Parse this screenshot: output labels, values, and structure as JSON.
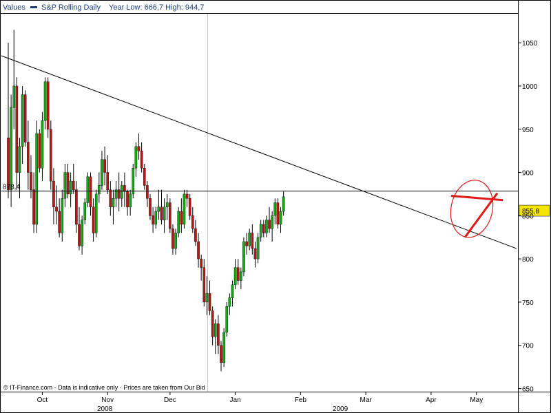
{
  "header": {
    "values_label": "Values",
    "series_label": "S&P Rolling Daily",
    "stats_label": "Year Low: 666,7 High: 944,7"
  },
  "footer": {
    "copyright": "© IT-Finance.com - Data is indicative only - Prices are taken from Our Bid"
  },
  "price_marker": {
    "value": "855,8",
    "color": "#f3e500"
  },
  "level_label": "878,4",
  "colors": {
    "up": "#1aa81a",
    "down": "#b81818",
    "annotation": "#e01818",
    "trendline": "#000000"
  },
  "chart_data": {
    "type": "candlestick",
    "title": "S&P Rolling Daily",
    "ylim": [
      648,
      1082
    ],
    "y_ticks": [
      650,
      700,
      750,
      800,
      850,
      900,
      950,
      1000,
      1050
    ],
    "months": [
      {
        "label": "Oct",
        "idx": 12
      },
      {
        "label": "Nov",
        "idx": 35
      },
      {
        "label": "Dec",
        "idx": 57
      },
      {
        "label": "Jan",
        "idx": 80
      },
      {
        "label": "Feb",
        "idx": 103
      },
      {
        "label": "Mar",
        "idx": 126
      },
      {
        "label": "Apr",
        "idx": 149
      },
      {
        "label": "May",
        "idx": 165
      }
    ],
    "years": [
      {
        "label": "2008",
        "idx": 34
      },
      {
        "label": "2009",
        "idx": 117
      }
    ],
    "horizontal_level": 878.4,
    "trendline": {
      "from": [
        0,
        1035
      ],
      "to": [
        170,
        812
      ]
    },
    "candles": [
      [
        940,
        1050,
        870,
        880
      ],
      [
        880,
        990,
        860,
        975
      ],
      [
        975,
        1065,
        950,
        1000
      ],
      [
        1000,
        1010,
        880,
        900
      ],
      [
        900,
        940,
        870,
        930
      ],
      [
        930,
        1000,
        910,
        990
      ],
      [
        990,
        995,
        930,
        935
      ],
      [
        935,
        960,
        880,
        900
      ],
      [
        900,
        920,
        870,
        880
      ],
      [
        880,
        900,
        830,
        840
      ],
      [
        840,
        960,
        830,
        945
      ],
      [
        945,
        950,
        900,
        905
      ],
      [
        905,
        970,
        890,
        960
      ],
      [
        960,
        1010,
        950,
        1005
      ],
      [
        1005,
        1010,
        940,
        950
      ],
      [
        950,
        960,
        880,
        890
      ],
      [
        890,
        905,
        840,
        860
      ],
      [
        860,
        885,
        840,
        855
      ],
      [
        855,
        870,
        825,
        830
      ],
      [
        830,
        880,
        820,
        870
      ],
      [
        870,
        910,
        860,
        900
      ],
      [
        900,
        910,
        870,
        875
      ],
      [
        875,
        900,
        860,
        890
      ],
      [
        890,
        910,
        875,
        880
      ],
      [
        880,
        890,
        830,
        840
      ],
      [
        840,
        860,
        810,
        815
      ],
      [
        815,
        850,
        805,
        845
      ],
      [
        845,
        870,
        840,
        865
      ],
      [
        865,
        900,
        860,
        895
      ],
      [
        895,
        900,
        850,
        860
      ],
      [
        860,
        870,
        820,
        830
      ],
      [
        830,
        880,
        825,
        875
      ],
      [
        875,
        900,
        865,
        885
      ],
      [
        885,
        925,
        880,
        915
      ],
      [
        915,
        930,
        885,
        900
      ],
      [
        900,
        920,
        875,
        880
      ],
      [
        880,
        890,
        850,
        860
      ],
      [
        860,
        880,
        840,
        870
      ],
      [
        870,
        890,
        860,
        880
      ],
      [
        880,
        900,
        855,
        870
      ],
      [
        870,
        890,
        860,
        885
      ],
      [
        885,
        900,
        860,
        878
      ],
      [
        878,
        880,
        850,
        860
      ],
      [
        860,
        880,
        850,
        875
      ],
      [
        875,
        910,
        870,
        905
      ],
      [
        905,
        935,
        895,
        930
      ],
      [
        930,
        945,
        915,
        925
      ],
      [
        925,
        935,
        900,
        905
      ],
      [
        905,
        910,
        880,
        885
      ],
      [
        885,
        890,
        860,
        870
      ],
      [
        870,
        875,
        845,
        850
      ],
      [
        850,
        860,
        830,
        840
      ],
      [
        840,
        860,
        835,
        855
      ],
      [
        855,
        880,
        845,
        860
      ],
      [
        860,
        880,
        840,
        845
      ],
      [
        845,
        870,
        830,
        860
      ],
      [
        860,
        875,
        845,
        865
      ],
      [
        865,
        870,
        830,
        835
      ],
      [
        835,
        840,
        805,
        812
      ],
      [
        812,
        835,
        805,
        830
      ],
      [
        830,
        860,
        825,
        855
      ],
      [
        855,
        870,
        830,
        840
      ],
      [
        840,
        880,
        835,
        875
      ],
      [
        875,
        880,
        860,
        870
      ],
      [
        870,
        875,
        845,
        850
      ],
      [
        850,
        860,
        830,
        835
      ],
      [
        835,
        845,
        815,
        820
      ],
      [
        820,
        830,
        790,
        800
      ],
      [
        800,
        805,
        775,
        790
      ],
      [
        790,
        800,
        745,
        750
      ],
      [
        750,
        780,
        735,
        760
      ],
      [
        760,
        775,
        735,
        740
      ],
      [
        740,
        745,
        700,
        710
      ],
      [
        710,
        730,
        690,
        725
      ],
      [
        725,
        735,
        690,
        700
      ],
      [
        700,
        705,
        670,
        680
      ],
      [
        680,
        720,
        675,
        715
      ],
      [
        715,
        750,
        710,
        745
      ],
      [
        745,
        760,
        735,
        755
      ],
      [
        755,
        775,
        745,
        770
      ],
      [
        770,
        800,
        765,
        790
      ],
      [
        790,
        800,
        770,
        775
      ],
      [
        775,
        790,
        765,
        785
      ],
      [
        785,
        825,
        780,
        820
      ],
      [
        820,
        830,
        805,
        815
      ],
      [
        815,
        835,
        810,
        830
      ],
      [
        830,
        840,
        805,
        812
      ],
      [
        812,
        820,
        790,
        800
      ],
      [
        800,
        830,
        795,
        825
      ],
      [
        825,
        845,
        820,
        840
      ],
      [
        840,
        845,
        825,
        830
      ],
      [
        830,
        850,
        825,
        845
      ],
      [
        845,
        860,
        830,
        835
      ],
      [
        835,
        855,
        820,
        850
      ],
      [
        850,
        870,
        840,
        865
      ],
      [
        865,
        870,
        835,
        840
      ],
      [
        840,
        860,
        830,
        855
      ],
      [
        855,
        878,
        850,
        872
      ]
    ]
  }
}
